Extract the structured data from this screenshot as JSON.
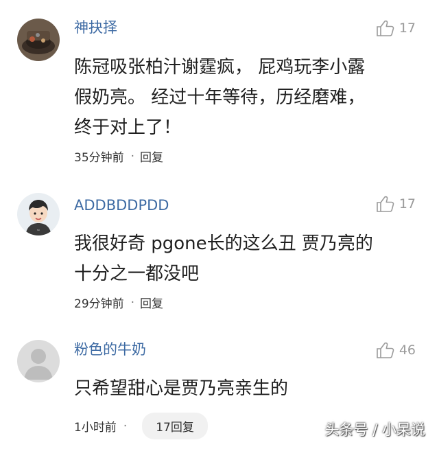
{
  "comments": [
    {
      "username": "神抉择",
      "avatar_icon": "dark-food-photo-avatar",
      "likes": "17",
      "lines": [
        "陈冠吸张柏汁谢霆疯， 屁鸡玩李小露",
        "假奶亮。 经过十年等待，历经磨难，",
        "终于对上了！"
      ],
      "time": "35分钟前",
      "reply_label": "回复"
    },
    {
      "username": "ADDBDDPDD",
      "avatar_icon": "cartoon-boy-avatar",
      "likes": "17",
      "lines": [
        "我很好奇 pgone长的这么丑 贾乃亮的",
        "十分之一都没吧"
      ],
      "time": "29分钟前",
      "reply_label": "回复"
    },
    {
      "username": "粉色的牛奶",
      "avatar_icon": "default-user-avatar",
      "likes": "46",
      "lines": [
        "只希望甜心是贾乃亮亲生的"
      ],
      "time": "1小时前",
      "reply_label": "17回复"
    }
  ],
  "dot": "·",
  "watermark": "头条号 / 小呆说",
  "colors": {
    "username": "#3d6aa3",
    "like": "#9a9a9a",
    "pill_bg": "#f1f1f1"
  }
}
